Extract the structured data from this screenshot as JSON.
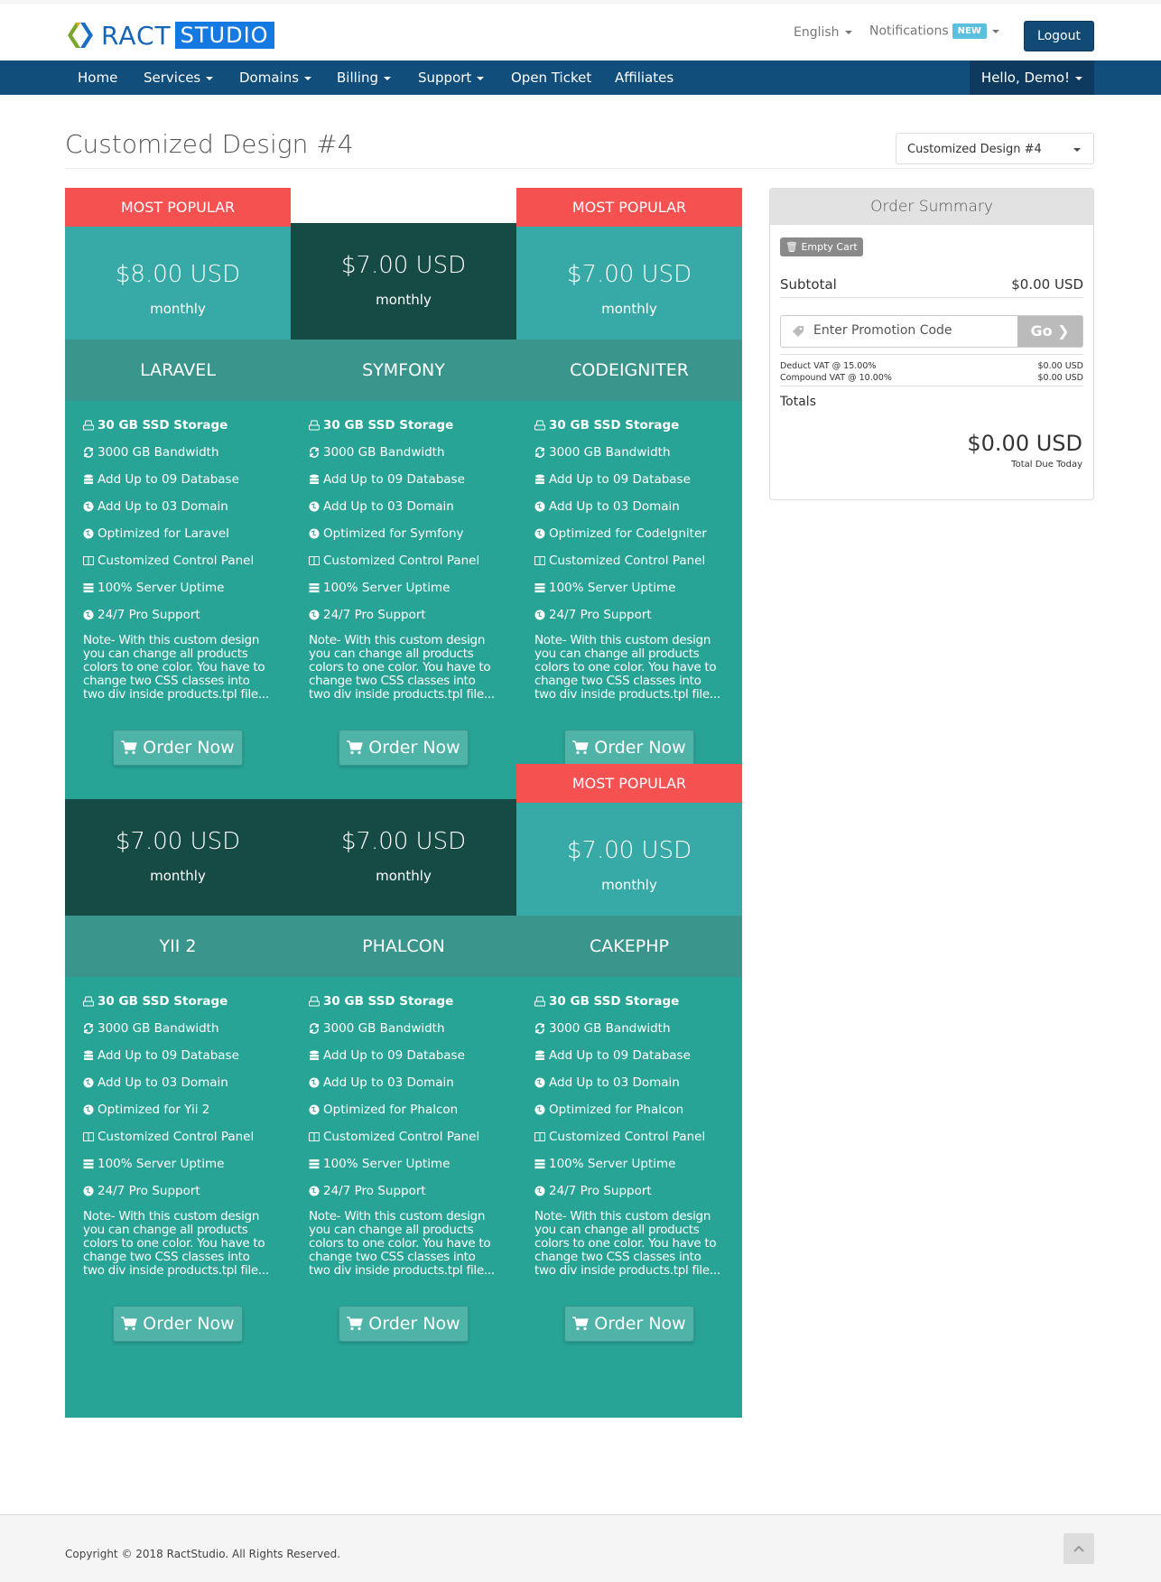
{
  "header": {
    "logo_part1": "RACT",
    "logo_part2": "STUDIO",
    "language": "English",
    "notifications": "Notifications",
    "notifications_badge": "NEW",
    "logout": "Logout"
  },
  "nav": {
    "items": [
      "Home",
      "Services",
      "Domains",
      "Billing",
      "Support",
      "Open Ticket",
      "Affiliates"
    ],
    "user": "Hello, Demo!"
  },
  "page": {
    "title": "Customized Design #4",
    "select_value": "Customized Design #4"
  },
  "colors": {
    "popular": "#f55151",
    "price_light": "#37aaa7",
    "price_dark": "#164b45",
    "name_band": "#3a968d",
    "features": "#27a496",
    "nav": "#124e7c"
  },
  "products": [
    {
      "popular": "MOST POPULAR",
      "price": "$8.00 USD",
      "period": "monthly",
      "name": "LARAVEL",
      "optimized": "Optimized for Laravel",
      "dark": false
    },
    {
      "popular": "",
      "price": "$7.00 USD",
      "period": "monthly",
      "name": "SYMFONY",
      "optimized": "Optimized for Symfony",
      "dark": true
    },
    {
      "popular": "MOST POPULAR",
      "price": "$7.00 USD",
      "period": "monthly",
      "name": "CODEIGNITER",
      "optimized": "Optimized for CodeIgniter",
      "dark": false
    },
    {
      "popular": "",
      "price": "$7.00 USD",
      "period": "monthly",
      "name": "YII 2",
      "optimized": "Optimized for Yii 2",
      "dark": true
    },
    {
      "popular": "",
      "price": "$7.00 USD",
      "period": "monthly",
      "name": "PHALCON",
      "optimized": "Optimized for Phalcon",
      "dark": true
    },
    {
      "popular": "MOST POPULAR",
      "price": "$7.00 USD",
      "period": "monthly",
      "name": "CAKEPHP",
      "optimized": "Optimized for Phalcon",
      "dark": false
    }
  ],
  "features": {
    "storage": "30 GB SSD Storage",
    "bandwidth": "3000 GB Bandwidth",
    "database": "Add Up to 09 Database",
    "domain": "Add Up to 03 Domain",
    "panel": "Customized Control Panel",
    "uptime": "100% Server Uptime",
    "support": "24/7 Pro Support",
    "note": "Note- With this custom design you can change all products colors to one color. You have to change two CSS classes into two div inside products.tpl file...",
    "order_button": "Order Now"
  },
  "summary": {
    "title": "Order Summary",
    "empty_cart": "Empty Cart",
    "subtotal_label": "Subtotal",
    "subtotal_value": "$0.00 USD",
    "promo_placeholder": "Enter Promotion Code",
    "promo_button": "Go",
    "vat1_label": "Deduct VAT @ 15.00%",
    "vat1_value": "$0.00 USD",
    "vat2_label": "Compound VAT @ 10.00%",
    "vat2_value": "$0.00 USD",
    "totals_label": "Totals",
    "total_value": "$0.00 USD",
    "total_due": "Total Due Today"
  },
  "footer": {
    "copyright": "Copyright © 2018 RactStudio. All Rights Reserved."
  }
}
